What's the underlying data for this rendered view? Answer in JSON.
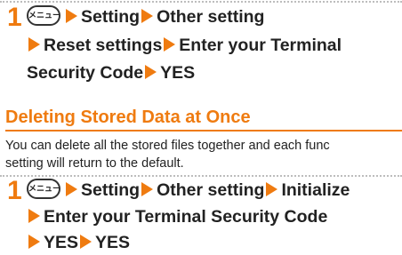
{
  "step1": {
    "number": "1",
    "menu_key": "メニュー",
    "line1": [
      "Setting",
      "Other setting"
    ],
    "line2": [
      "Reset settings",
      "Enter your Terminal"
    ],
    "line3_text": "Security Code",
    "line3": [
      "YES"
    ]
  },
  "section": {
    "title": "Deleting Stored Data at Once",
    "description_line1": "You can delete all the stored files together and each func",
    "description_line2": "setting will return to the default."
  },
  "step2": {
    "number": "1",
    "menu_key": "メニュー",
    "line1": [
      "Setting",
      "Other setting",
      "Initialize"
    ],
    "line2": [
      "Enter your Terminal Security Code"
    ],
    "line3": [
      "YES",
      "YES"
    ]
  },
  "colors": {
    "accent": "#ef7b10",
    "text": "#222222",
    "dots": "#bdbdbd"
  },
  "icons": {
    "menu_key": "menu-key-icon",
    "arrow": "orange-triangle-arrow-icon"
  }
}
